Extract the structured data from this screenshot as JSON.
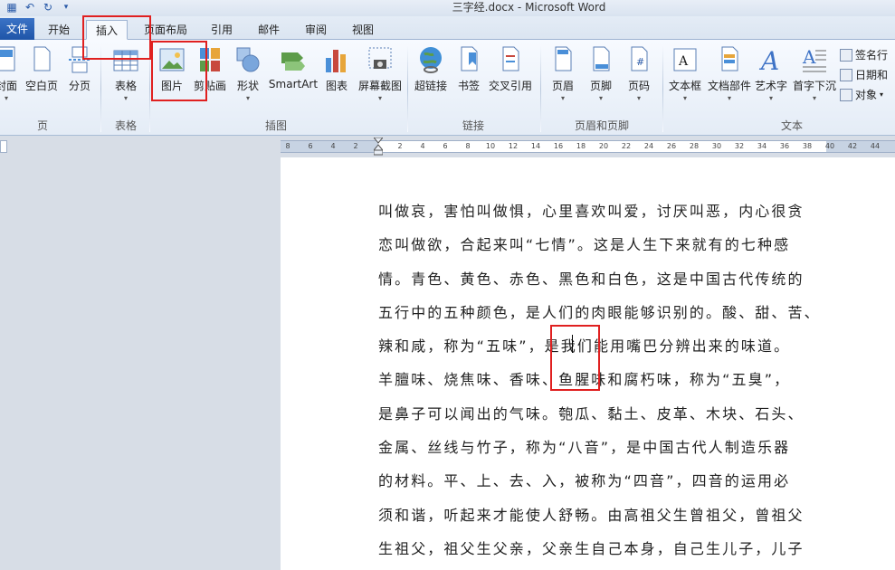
{
  "window": {
    "title": "三字经.docx - Microsoft Word"
  },
  "qat": {
    "save_icon": "save-icon",
    "undo_icon": "undo-icon",
    "redo_icon": "redo-icon",
    "customize_icon": "chevron-down-icon"
  },
  "tabs": [
    {
      "label": "文件"
    },
    {
      "label": "开始"
    },
    {
      "label": "插入",
      "active": true
    },
    {
      "label": "页面布局"
    },
    {
      "label": "引用"
    },
    {
      "label": "邮件"
    },
    {
      "label": "审阅"
    },
    {
      "label": "视图"
    }
  ],
  "ribbon": {
    "buttons": [
      {
        "label": "封面"
      },
      {
        "label": "空白页"
      },
      {
        "label": "分页"
      },
      {
        "label": "表格"
      },
      {
        "label": "图片"
      },
      {
        "label": "剪贴画"
      },
      {
        "label": "形状"
      },
      {
        "label": "SmartArt"
      },
      {
        "label": "图表"
      },
      {
        "label": "屏幕截图"
      },
      {
        "label": "超链接"
      },
      {
        "label": "书签"
      },
      {
        "label": "交叉引用"
      },
      {
        "label": "页眉"
      },
      {
        "label": "页脚"
      },
      {
        "label": "页码"
      },
      {
        "label": "文本框"
      },
      {
        "label": "文档部件"
      },
      {
        "label": "艺术字"
      },
      {
        "label": "首字下沉"
      }
    ],
    "small_buttons": [
      {
        "label": "签名行"
      },
      {
        "label": "日期和"
      },
      {
        "label": "对象"
      }
    ],
    "groups": [
      {
        "label": "页"
      },
      {
        "label": "表格"
      },
      {
        "label": "插图"
      },
      {
        "label": "链接"
      },
      {
        "label": "页眉和页脚"
      },
      {
        "label": "文本"
      }
    ]
  },
  "ruler": {
    "ticks": [
      "8",
      "6",
      "4",
      "2",
      "2",
      "4",
      "6",
      "8",
      "10",
      "12",
      "14",
      "16",
      "18",
      "20",
      "22",
      "24",
      "26",
      "28",
      "30",
      "32",
      "34",
      "36",
      "38",
      "40",
      "42",
      "44"
    ]
  },
  "document": {
    "lines": [
      "叫做哀，害怕叫做惧，心里喜欢叫爱，讨厌叫恶，内心很贪",
      "恋叫做欲，合起来叫“七情”。这是人生下来就有的七种感",
      "情。青色、黄色、赤色、黑色和白色，这是中国古代传统的",
      "五行中的五种颜色，是人们的肉眼能够识别的。酸、甜、苦、",
      "辣和咸，称为“五味”，是我们能用嘴巴分辨出来的味道。",
      "羊膻味、烧焦味、香味、鱼腥味和腐朽味，称为“五臭”，",
      "是鼻子可以闻出的气味。匏瓜、黏土、皮革、木块、石头、",
      "金属、丝线与竹子，称为“八音”，是中国古代人制造乐器",
      "的材料。平、上、去、入，被称为“四音”，四音的运用必",
      "须和谐，听起来才能使人舒畅。由高祖父生曾祖父，曾祖父",
      "生祖父，祖父生父亲，父亲生自己本身，自己生儿子，儿子"
    ]
  },
  "colors": {
    "accent": "#2a5aa8",
    "annotation": "#e02020",
    "file_tab": "#2b62b6"
  }
}
